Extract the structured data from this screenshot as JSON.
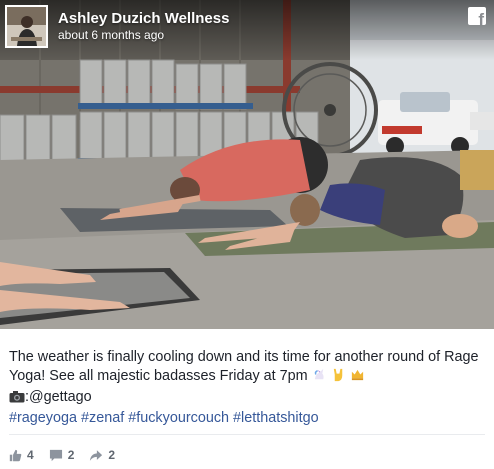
{
  "post": {
    "page_name": "Ashley Duzich Wellness",
    "timestamp": "about 6 months ago",
    "platform_icon": "facebook-icon",
    "platform_glyph": "f",
    "caption_line1": "The weather is finally cooling down and its time for another round of Rage",
    "caption_line2": "Yoga! See all majestic badasses Friday at 7pm",
    "caption_emojis": [
      "unicorn-icon",
      "rock-on-hand-icon",
      "crown-icon"
    ],
    "camera_credit": ":@gettago",
    "hashtags": [
      "#rageyoga",
      "#zenaf",
      "#fuckyourcouch",
      "#letthatshitgo"
    ],
    "stats": {
      "likes": "4",
      "comments": "2",
      "shares": "2"
    },
    "colors": {
      "link": "#365899",
      "text": "#1d2129",
      "meta": "#606770"
    }
  }
}
